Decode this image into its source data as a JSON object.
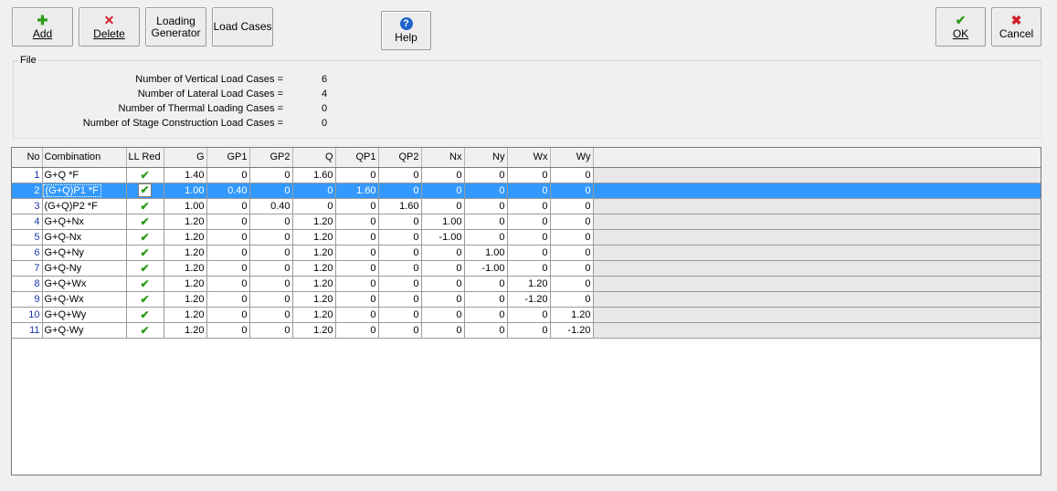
{
  "toolbar": {
    "add_label": "Add",
    "delete_label": "Delete",
    "loading_generator_line1": "Loading",
    "loading_generator_line2": "Generator",
    "load_cases_label": "Load Cases",
    "help_label": "Help",
    "ok_label": "OK",
    "cancel_label": "Cancel"
  },
  "file_group": {
    "legend": "File",
    "rows": [
      {
        "label": "Number of Vertical Load Cases =",
        "value": "6"
      },
      {
        "label": "Number of Lateral Load Cases =",
        "value": "4"
      },
      {
        "label": "Number of Thermal Loading Cases =",
        "value": "0"
      },
      {
        "label": "Number of Stage Construction Load Cases =",
        "value": "0"
      }
    ]
  },
  "grid": {
    "columns": [
      "No",
      "Combination",
      "LL Red",
      "G",
      "GP1",
      "GP2",
      "Q",
      "QP1",
      "QP2",
      "Nx",
      "Ny",
      "Wx",
      "Wy"
    ],
    "selected_row": 2,
    "rows": [
      {
        "no": "1",
        "combination": "G+Q *F",
        "ll_red": true,
        "values": [
          "1.40",
          "0",
          "0",
          "1.60",
          "0",
          "0",
          "0",
          "0",
          "0",
          "0"
        ]
      },
      {
        "no": "2",
        "combination": "(G+Q)P1 *F",
        "ll_red": true,
        "values": [
          "1.00",
          "0.40",
          "0",
          "0",
          "1.60",
          "0",
          "0",
          "0",
          "0",
          "0"
        ]
      },
      {
        "no": "3",
        "combination": "(G+Q)P2 *F",
        "ll_red": true,
        "values": [
          "1.00",
          "0",
          "0.40",
          "0",
          "0",
          "1.60",
          "0",
          "0",
          "0",
          "0"
        ]
      },
      {
        "no": "4",
        "combination": "G+Q+Nx",
        "ll_red": true,
        "values": [
          "1.20",
          "0",
          "0",
          "1.20",
          "0",
          "0",
          "1.00",
          "0",
          "0",
          "0"
        ]
      },
      {
        "no": "5",
        "combination": "G+Q-Nx",
        "ll_red": true,
        "values": [
          "1.20",
          "0",
          "0",
          "1.20",
          "0",
          "0",
          "-1.00",
          "0",
          "0",
          "0"
        ]
      },
      {
        "no": "6",
        "combination": "G+Q+Ny",
        "ll_red": true,
        "values": [
          "1.20",
          "0",
          "0",
          "1.20",
          "0",
          "0",
          "0",
          "1.00",
          "0",
          "0"
        ]
      },
      {
        "no": "7",
        "combination": "G+Q-Ny",
        "ll_red": true,
        "values": [
          "1.20",
          "0",
          "0",
          "1.20",
          "0",
          "0",
          "0",
          "-1.00",
          "0",
          "0"
        ]
      },
      {
        "no": "8",
        "combination": "G+Q+Wx",
        "ll_red": true,
        "values": [
          "1.20",
          "0",
          "0",
          "1.20",
          "0",
          "0",
          "0",
          "0",
          "1.20",
          "0"
        ]
      },
      {
        "no": "9",
        "combination": "G+Q-Wx",
        "ll_red": true,
        "values": [
          "1.20",
          "0",
          "0",
          "1.20",
          "0",
          "0",
          "0",
          "0",
          "-1.20",
          "0"
        ]
      },
      {
        "no": "10",
        "combination": "G+Q+Wy",
        "ll_red": true,
        "values": [
          "1.20",
          "0",
          "0",
          "1.20",
          "0",
          "0",
          "0",
          "0",
          "0",
          "1.20"
        ]
      },
      {
        "no": "11",
        "combination": "G+Q-Wy",
        "ll_red": true,
        "values": [
          "1.20",
          "0",
          "0",
          "1.20",
          "0",
          "0",
          "0",
          "0",
          "0",
          "-1.20"
        ]
      }
    ]
  },
  "icons": {
    "add": "plus-icon",
    "delete": "x-icon",
    "help": "question-icon",
    "ok": "checkmark-icon",
    "cancel": "x-icon",
    "ll_red": "checkmark-icon"
  },
  "colors": {
    "selection": "#3399ff",
    "check_green": "#2e9b1a",
    "delete_red": "#d0202a",
    "help_blue": "#1e63c8",
    "row_number": "#1a35a8"
  }
}
